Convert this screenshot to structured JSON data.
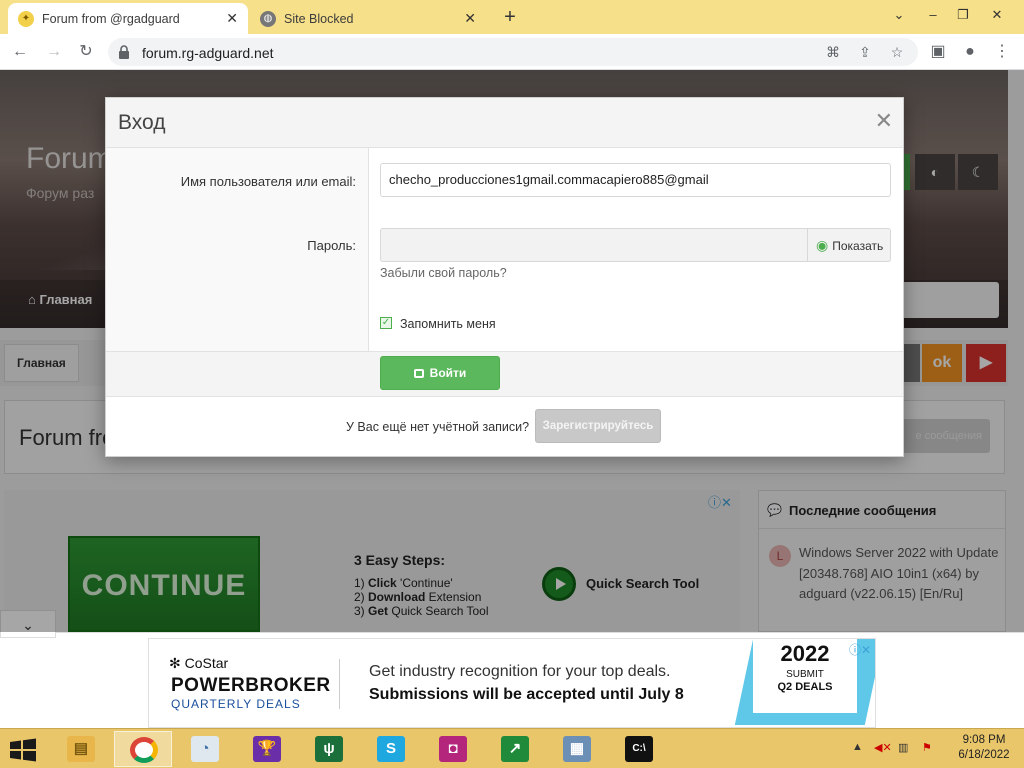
{
  "browser": {
    "tabs": [
      {
        "title": "Forum from @rgadguard",
        "active": true
      },
      {
        "title": "Site Blocked",
        "active": false
      }
    ],
    "url": "forum.rg-adguard.net"
  },
  "page": {
    "hero_title": "Forum",
    "hero_subtitle": "Форум раз",
    "nav_home": "Главная",
    "breadcrumb": "Главная",
    "forum_title": "Forum fro",
    "new_messages_button": "е сообщения",
    "ad_continue": "CONTINUE",
    "ad_steps_title": "3 Easy Steps:",
    "ad_steps": [
      {
        "num": "1)",
        "bold": "Click",
        "rest": " 'Continue'"
      },
      {
        "num": "2)",
        "bold": "Download",
        "rest": " Extension"
      },
      {
        "num": "3)",
        "bold": "Get",
        "rest": " Quick Search Tool"
      }
    ],
    "ad_quick_search": "Quick Search Tool",
    "sidebar_title": "Последние сообщения",
    "sidebar_avatar_letter": "L",
    "sidebar_post": "Windows Server 2022 with Update [20348.768] AIO 10in1 (x64) by adguard (v22.06.15) [En/Ru]"
  },
  "bottom_ad": {
    "brand": "CoStar",
    "product": "POWERBROKER",
    "tagline": "QUARTERLY DEALS",
    "line1": "Get industry recognition for your top deals.",
    "line2": "Submissions will be accepted until July 8",
    "badge_year": "2022",
    "badge_submit": "SUBMIT",
    "badge_q2": "Q2 DEALS"
  },
  "modal": {
    "title": "Вход",
    "username_label": "Имя пользователя или email:",
    "username_value": "checho_producciones1gmail.commacapiero885@gmail",
    "password_label": "Пароль:",
    "show_password": "Показать",
    "forgot_password": "Забыли свой пароль?",
    "remember_me": "Запомнить меня",
    "remember_checked": true,
    "login_button": "Войти",
    "no_account_text": "У Вас ещё нет учётной записи?",
    "register_button": "Зарегистрируйтесь"
  },
  "taskbar": {
    "time": "9:08 PM",
    "date": "6/18/2022"
  },
  "colors": {
    "tabstrip": "#f7e08a",
    "login_green": "#5cb85c",
    "taskbar": "#e9c66a"
  }
}
